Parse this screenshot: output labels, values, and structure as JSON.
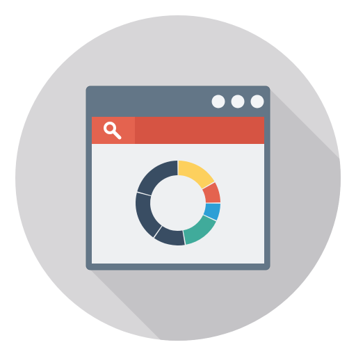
{
  "icon": {
    "name": "browser-analytics-icon",
    "colors": {
      "background_circle": "#d7d6d8",
      "long_shadow": "#c4c3c6",
      "window_frame": "#637687",
      "window_frame_edge": "#5a6d7d",
      "window_body": "#eef0f2",
      "window_dots": "#f3f5f7",
      "search_bar": "#d65443",
      "search_button": "#e4634f",
      "search_glyph": "#ffffff"
    }
  },
  "chart_data": {
    "type": "pie",
    "style": "donut",
    "segments": [
      {
        "color": "#fdd05d",
        "value": 0.1667
      },
      {
        "color": "#e4634f",
        "value": 0.0833
      },
      {
        "color": "#2d9fd6",
        "value": 0.0694
      },
      {
        "color": "#40ab9b",
        "value": 0.1528
      },
      {
        "color": "#394d63",
        "value": 0.125
      },
      {
        "color": "#394d63",
        "value": 0.1944
      },
      {
        "color": "#394d63",
        "value": 0.2083
      }
    ]
  }
}
